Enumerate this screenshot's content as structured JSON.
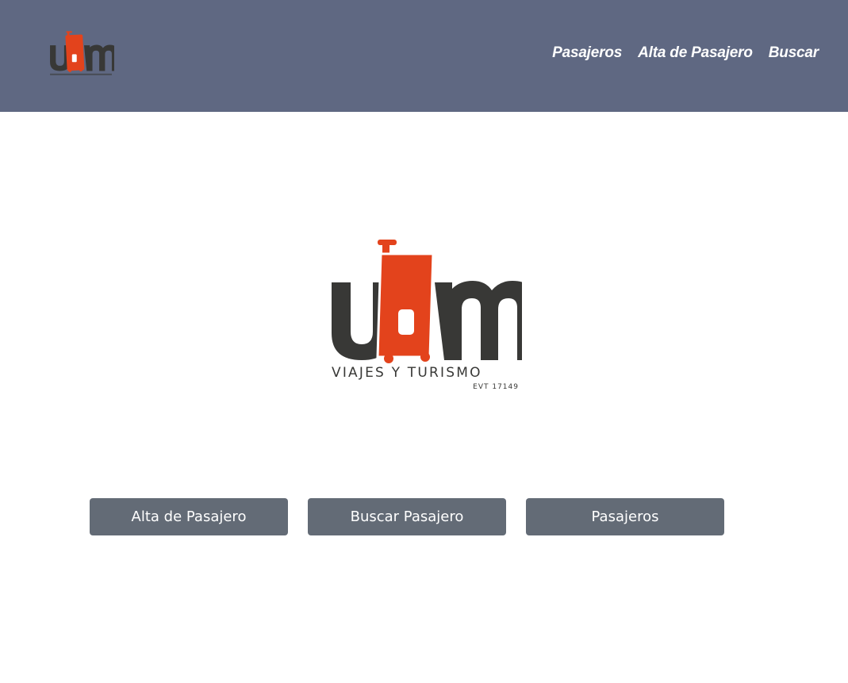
{
  "header": {
    "logo_name": "ubm-logo",
    "logo_caption": "VIAJES Y TURISMO",
    "nav": [
      {
        "label": "Pasajeros"
      },
      {
        "label": "Alta de Pasajero"
      },
      {
        "label": "Buscar"
      }
    ]
  },
  "hero": {
    "logo_text": "ubm",
    "tagline": "VIAJES Y TURISMO",
    "license": "EVT 17149"
  },
  "actions": [
    {
      "label": "Alta de Pasajero"
    },
    {
      "label": "Buscar Pasajero"
    },
    {
      "label": "Pasajeros"
    }
  ],
  "colors": {
    "header_bg": "#5f6882",
    "button_bg": "#636b76",
    "logo_dark": "#383836",
    "logo_accent": "#e3431c"
  }
}
